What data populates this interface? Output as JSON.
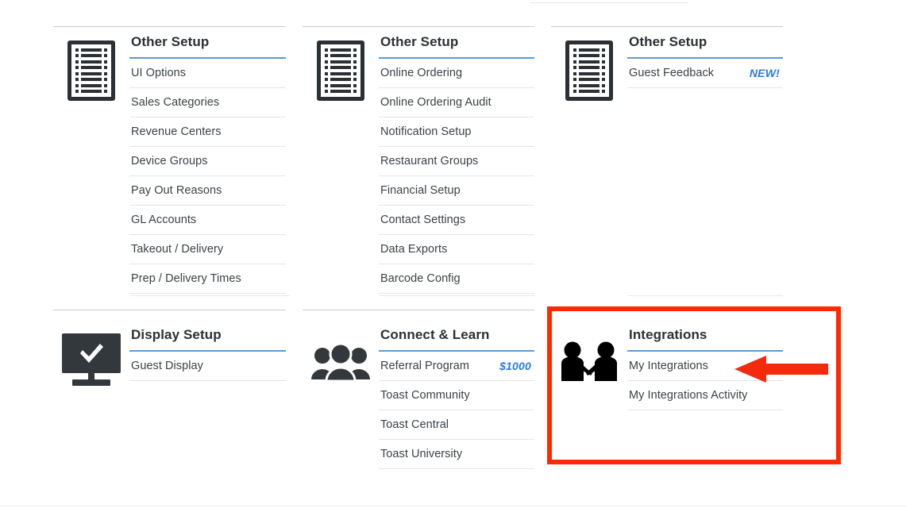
{
  "theme": {
    "accent_underline": "#5b9bd5",
    "badge_blue": "#2a7ade",
    "highlight_red": "#ff2a00",
    "icon_dark": "#2b3034",
    "text": "#3c4146"
  },
  "cards": {
    "other_setup_1": {
      "title": "Other Setup",
      "icon": "document-icon",
      "items": [
        {
          "label": "UI Options"
        },
        {
          "label": "Sales Categories"
        },
        {
          "label": "Revenue Centers"
        },
        {
          "label": "Device Groups"
        },
        {
          "label": "Pay Out Reasons"
        },
        {
          "label": "GL Accounts"
        },
        {
          "label": "Takeout / Delivery"
        },
        {
          "label": "Prep / Delivery Times"
        }
      ]
    },
    "other_setup_2": {
      "title": "Other Setup",
      "icon": "document-icon",
      "items": [
        {
          "label": "Online Ordering"
        },
        {
          "label": "Online Ordering Audit"
        },
        {
          "label": "Notification Setup"
        },
        {
          "label": "Restaurant Groups"
        },
        {
          "label": "Financial Setup"
        },
        {
          "label": "Contact Settings"
        },
        {
          "label": "Data Exports"
        },
        {
          "label": "Barcode Config"
        }
      ]
    },
    "other_setup_3": {
      "title": "Other Setup",
      "icon": "document-icon",
      "items": [
        {
          "label": "Guest Feedback",
          "badge": "NEW!"
        }
      ]
    },
    "display_setup": {
      "title": "Display Setup",
      "icon": "monitor-check-icon",
      "items": [
        {
          "label": "Guest Display"
        }
      ]
    },
    "connect_and_learn": {
      "title": "Connect & Learn",
      "icon": "people-group-icon",
      "items": [
        {
          "label": "Referral Program",
          "badge": "$1000"
        },
        {
          "label": "Toast Community"
        },
        {
          "label": "Toast Central"
        },
        {
          "label": "Toast University"
        }
      ]
    },
    "integrations": {
      "title": "Integrations",
      "icon": "handshake-icon",
      "highlighted": true,
      "items": [
        {
          "label": "My Integrations"
        },
        {
          "label": "My Integrations Activity"
        }
      ]
    }
  },
  "annotations": {
    "highlight_box_target": "integrations-card",
    "arrow_target": "My Integrations",
    "arrow_direction": "left"
  }
}
